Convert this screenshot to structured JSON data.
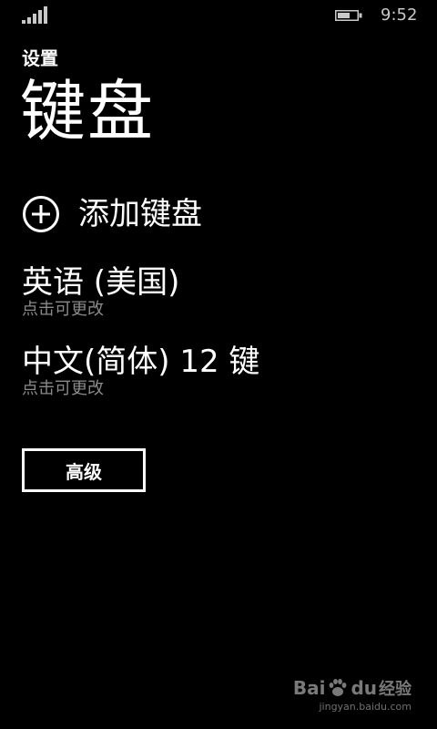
{
  "status_bar": {
    "time": "9:52",
    "icons": [
      "signal-icon",
      "battery-icon"
    ]
  },
  "header": {
    "app_title": "设置",
    "page_title": "键盘"
  },
  "actions": {
    "add_keyboard": {
      "icon": "plus-circle-icon",
      "label": "添加键盘"
    }
  },
  "keyboards": [
    {
      "name": "英语 (美国)",
      "hint": "点击可更改"
    },
    {
      "name": "中文(简体) 12 键",
      "hint": "点击可更改"
    }
  ],
  "buttons": {
    "advanced": "高级"
  },
  "watermark": {
    "logo_left": "Bai",
    "logo_right": "du",
    "brand": "经验",
    "url": "jingyan.baidu.com"
  },
  "colors": {
    "background": "#000000",
    "foreground": "#ffffff",
    "subtext": "#8a8a8a"
  }
}
